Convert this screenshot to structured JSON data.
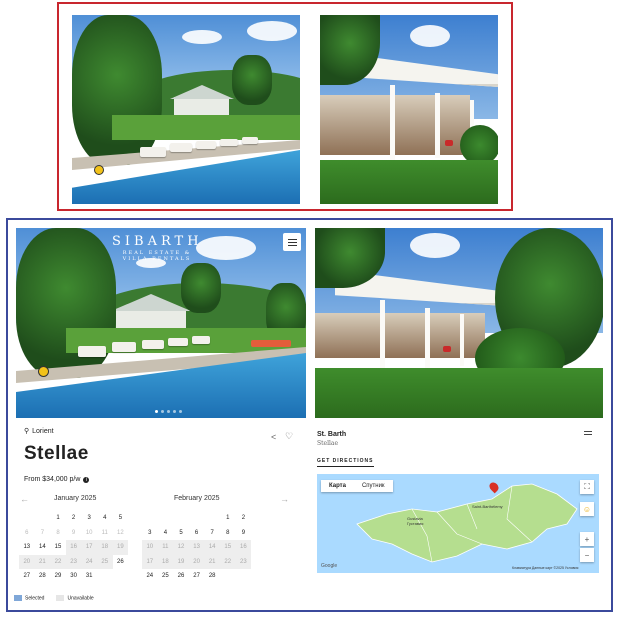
{
  "top_preview": {
    "images": [
      "pool-villa-photo",
      "covered-terrace-photo"
    ]
  },
  "header": {
    "logo_text": "SIBARTH",
    "logo_sub": "REAL ESTATE & VILLA RENTALS"
  },
  "listing": {
    "location": "Lorient",
    "title": "Stellae",
    "price": "From $34,000 p/w",
    "slide_count": 5,
    "active_slide": 1
  },
  "calendar": {
    "prev_label": "←",
    "next_label": "→",
    "months": [
      {
        "name": "January 2025",
        "weeks": [
          [
            "",
            "",
            "1",
            "2",
            "3",
            "4",
            "5"
          ],
          [
            "6",
            "7",
            "8",
            "9",
            "10",
            "11",
            "12"
          ],
          [
            "13",
            "14",
            "15",
            "16",
            "17",
            "18",
            "19"
          ],
          [
            "20",
            "21",
            "22",
            "23",
            "24",
            "25",
            "26"
          ],
          [
            "27",
            "28",
            "29",
            "30",
            "31",
            "",
            ""
          ]
        ]
      },
      {
        "name": "February 2025",
        "weeks": [
          [
            "",
            "",
            "",
            "",
            "",
            "1",
            "2"
          ],
          [
            "3",
            "4",
            "5",
            "6",
            "7",
            "8",
            "9"
          ],
          [
            "10",
            "11",
            "12",
            "13",
            "14",
            "15",
            "16"
          ],
          [
            "17",
            "18",
            "19",
            "20",
            "21",
            "22",
            "23"
          ],
          [
            "24",
            "25",
            "26",
            "27",
            "28",
            "",
            ""
          ]
        ]
      }
    ],
    "legend": {
      "selected": "Selected",
      "unavailable": "Unavailable",
      "selected_color": "#7fa7d8",
      "unavailable_color": "#e6e6e6"
    }
  },
  "right_panel": {
    "title": "St. Barth",
    "subtitle": "Stellae",
    "directions": "GET DIRECTIONS",
    "map": {
      "tab_map": "Карта",
      "tab_satellite": "Спутник",
      "labels": [
        "Gustavia",
        "Густавия",
        "Saint-Barthélemy"
      ],
      "footer": "Клавиатура   Данные карт ©2025   Условия",
      "google": "Google"
    }
  }
}
